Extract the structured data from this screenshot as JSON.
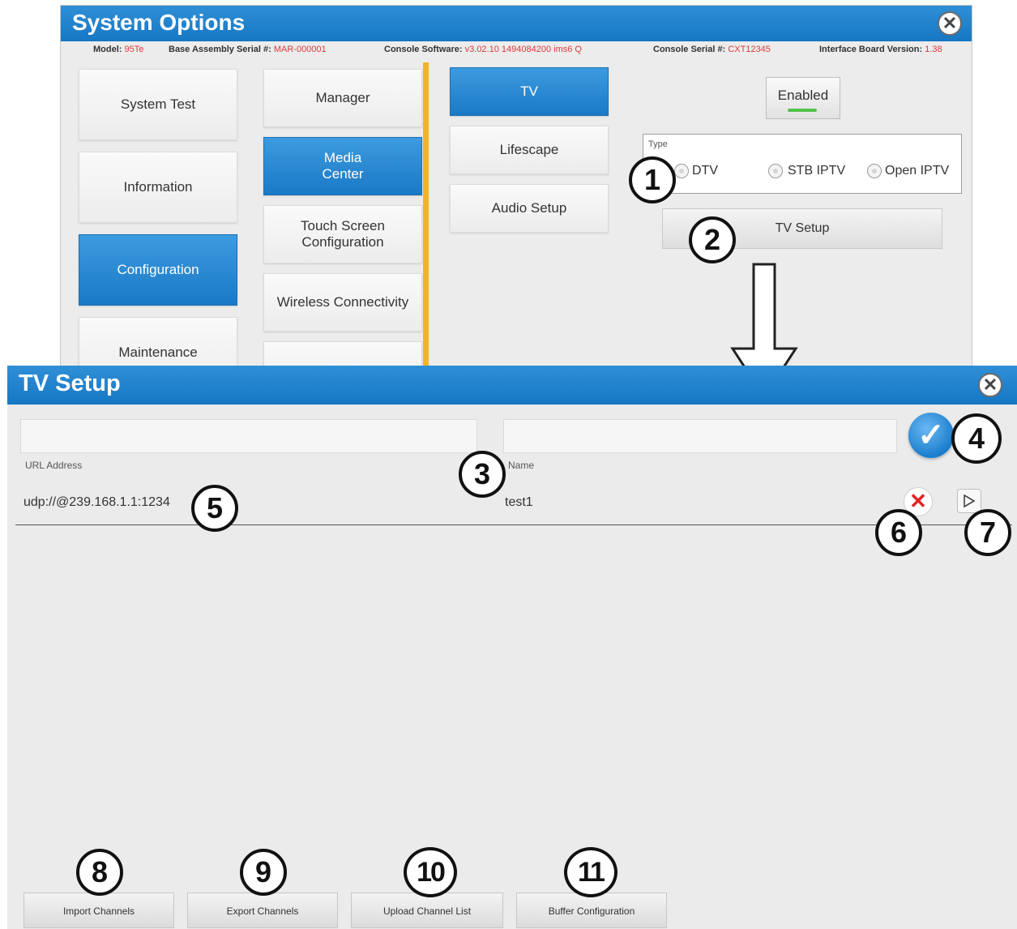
{
  "system_options": {
    "title": "System Options",
    "info": {
      "model_label": "Model:",
      "model_value": "95Te",
      "base_serial_label": "Base Assembly Serial #:",
      "base_serial_value": "MAR-000001",
      "console_sw_label": "Console Software:",
      "console_sw_value": "v3.02.10 1494084200 ims6 Q",
      "console_serial_label": "Console Serial #:",
      "console_serial_value": "CXT12345",
      "board_ver_label": "Interface Board Version:",
      "board_ver_value": "1.38"
    },
    "col1": [
      "System Test",
      "Information",
      "Configuration",
      "Maintenance"
    ],
    "col2": [
      "Manager",
      "Media\nCenter",
      "Touch Screen\nConfiguration",
      "Wireless Connectivity"
    ],
    "col3": [
      "TV",
      "Lifescape",
      "Audio Setup"
    ],
    "enabled_label": "Enabled",
    "type_label": "Type",
    "type_options": [
      "DTV",
      "STB IPTV",
      "Open IPTV"
    ],
    "tv_setup_button": "TV Setup"
  },
  "tv_setup": {
    "title": "TV Setup",
    "url_label": "URL Address",
    "name_label": "Name",
    "url_value": "",
    "name_value": "",
    "rows": [
      {
        "url": "udp://@239.168.1.1:1234",
        "name": "test1"
      }
    ],
    "buttons": [
      "Import Channels",
      "Export Channels",
      "Upload Channel List",
      "Buffer Configuration"
    ]
  },
  "callouts": [
    "1",
    "2",
    "3",
    "4",
    "5",
    "6",
    "7",
    "8",
    "9",
    "10",
    "11"
  ],
  "icons": {
    "close": "close-icon",
    "check": "checkmark-icon",
    "delete": "delete-x-icon",
    "play": "play-icon",
    "arrow": "down-arrow"
  },
  "colors": {
    "title_bar": "#1f82cc",
    "selected": "#1a79c6",
    "accent_yellow": "#f1b51f",
    "enabled_green": "#55c24b",
    "delete_red": "#e02323"
  }
}
